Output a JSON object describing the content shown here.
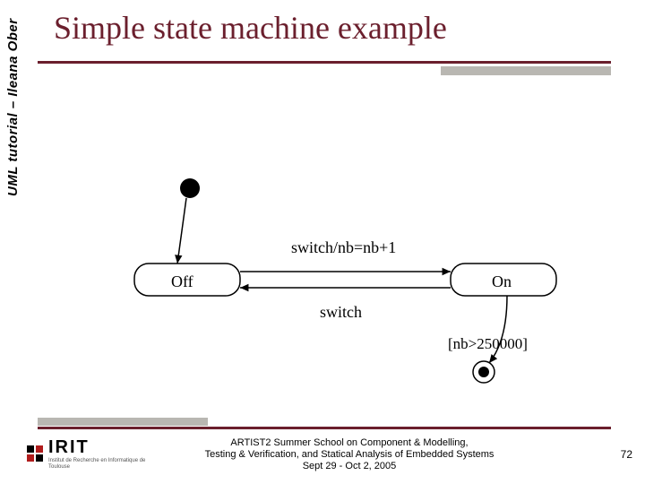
{
  "sidebar": "UML tutorial – Ileana Ober",
  "title": "Simple state machine example",
  "diagram": {
    "state_off": "Off",
    "state_on": "On",
    "transition_off_to_on": "switch/nb=nb+1",
    "transition_on_to_off": "switch",
    "guard_to_final": "[nb>250000]"
  },
  "footer": {
    "line1": "ARTIST2 Summer School on Component & Modelling,",
    "line2": "Testing & Verification, and Statical Analysis of Embedded Systems",
    "line3": "Sept 29 - Oct 2, 2005"
  },
  "logo": {
    "name": "IRIT",
    "sub": "Institut de Recherche en Informatique de Toulouse"
  },
  "page": "72"
}
